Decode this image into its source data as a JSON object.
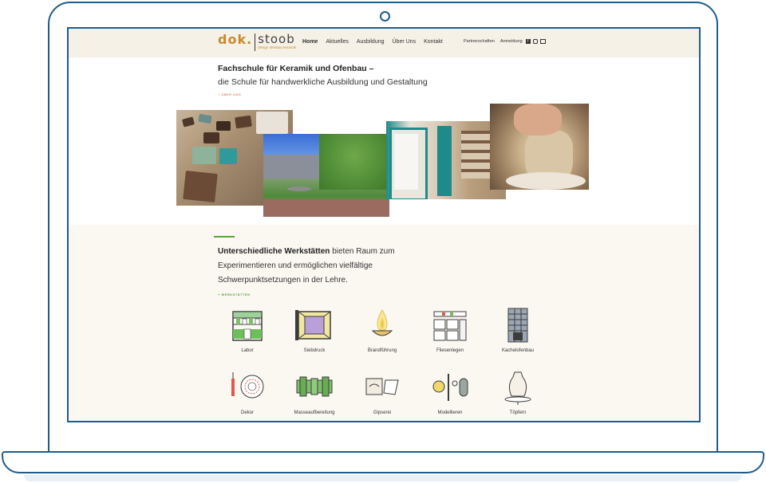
{
  "site": {
    "logo": {
      "brand_left": "dok.",
      "brand_right": "stoob",
      "tagline": "design ofenbau keramik"
    },
    "nav": [
      "Home",
      "Aktuelles",
      "Ausbildung",
      "Über Uns",
      "Kontakt"
    ],
    "nav_active": "Home",
    "util_nav": [
      "Partnerschaften",
      "Anmeldung"
    ],
    "social_icons": [
      "facebook-icon",
      "instagram-icon",
      "mail-icon"
    ]
  },
  "hero": {
    "title": "Fachschule für Keramik und Ofenbau –",
    "subtitle": "die Schule für handwerkliche Ausbildung und Gestaltung",
    "link": "+ ÜBER UNS",
    "photos": [
      "ceramic-tiles-photo",
      "courtyard-garden-photo",
      "kiln-workshop-photo",
      "pottery-wheel-photo"
    ]
  },
  "workshops": {
    "text_bold": "Unterschiedliche Werkstätten",
    "text_rest": " bieten Raum zum Experimentieren und ermöglichen vielfältige Schwerpunktsetzungen in der Lehre.",
    "link": "+ WERKSTÄTTEN",
    "items": [
      {
        "label": "Labor",
        "icon": "lab-shelf-icon"
      },
      {
        "label": "Siebdruck",
        "icon": "screen-print-frame-icon"
      },
      {
        "label": "Brandführung",
        "icon": "flame-bowl-icon"
      },
      {
        "label": "Fliesenlegen",
        "icon": "tile-level-icon"
      },
      {
        "label": "Kachelofenbau",
        "icon": "tile-stove-icon"
      },
      {
        "label": "Dekor",
        "icon": "decor-plate-icon"
      },
      {
        "label": "Masseaufbereitung",
        "icon": "clay-pipe-icon"
      },
      {
        "label": "Gipserei",
        "icon": "plaster-mold-icon"
      },
      {
        "label": "Modellieren",
        "icon": "modelling-tools-icon"
      },
      {
        "label": "Töpfern",
        "icon": "vase-wheel-icon"
      }
    ]
  },
  "colors": {
    "frame": "#1f5c8a",
    "accent_orange": "#c98a2e",
    "accent_green": "#5aa33c",
    "link_red": "#d94f3a",
    "page_bg": "#fbf8f2"
  }
}
